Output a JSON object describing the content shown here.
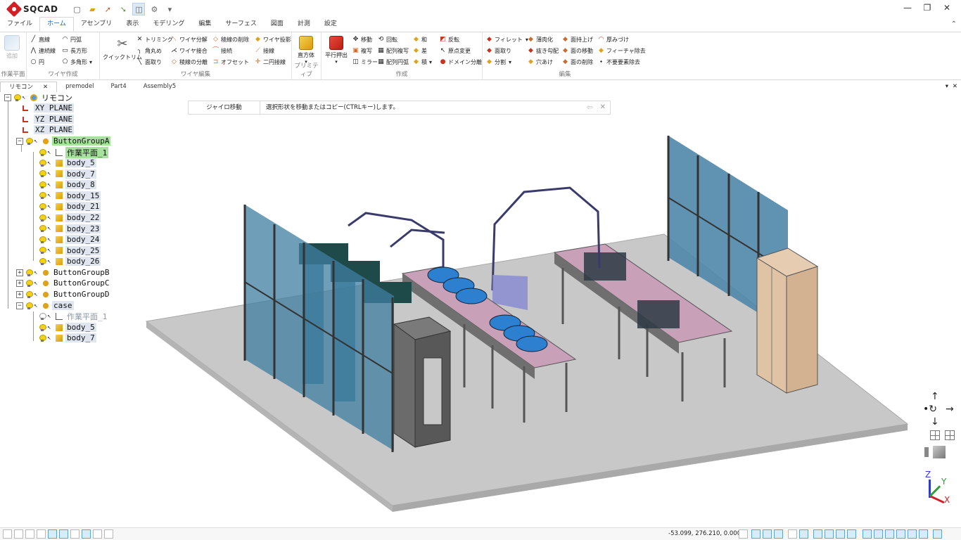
{
  "app": {
    "name": "SQCAD"
  },
  "window": {
    "minimize": "—",
    "restore": "❐",
    "close": "✕"
  },
  "menu": {
    "tabs": [
      "ファイル",
      "ホーム",
      "アセンブリ",
      "表示",
      "モデリング",
      "編集",
      "サーフェス",
      "図面",
      "計測",
      "設定"
    ],
    "active": "ホーム"
  },
  "ribbon": {
    "workplane": {
      "add": "追加",
      "title": "作業平面"
    },
    "wire_create": {
      "line": "直線",
      "arc": "円弧",
      "polyline": "連続線",
      "rect": "長方形",
      "circle": "円",
      "polygon": "多角形",
      "title": "ワイヤ作成"
    },
    "wire_edit": {
      "quicktrim": "クイックトリム",
      "trim": "トリミング",
      "wire_split": "ワイヤ分解",
      "edge_delete": "稜線の削除",
      "wire_project": "ワイヤ投影",
      "round": "角丸め",
      "wire_join": "ワイヤ接合",
      "tangent": "接続",
      "tangent_line": "接線",
      "chamfer": "面取り",
      "edge_split": "稜線の分離",
      "offset": "オフセット",
      "two_circle": "二円接線",
      "title": "ワイヤ編集"
    },
    "primitive": {
      "cube": "直方体",
      "title": "プリミティブ"
    },
    "create": {
      "extrude": "平行押出",
      "move": "移動",
      "rotate": "回転",
      "copy": "複写",
      "array": "配列複写",
      "mirror": "ミラー",
      "array_circle": "配列円弧",
      "union": "和",
      "diff": "差",
      "intersect": "積",
      "flip": "反転",
      "origin": "原点変更",
      "domain": "ドメイン分離",
      "title": "作成"
    },
    "edit": {
      "fillet": "フィレット",
      "chamfer": "面取り",
      "split": "分割",
      "shell": "薄肉化",
      "draft": "抜き勾配",
      "hole": "穴あけ",
      "face_offset": "面持上げ",
      "face_move": "面の移動",
      "face_delete": "面の削除",
      "thicken": "厚みづけ",
      "feature_remove": "フィーチャ除去",
      "cleanup": "不要要素除去",
      "title": "編集"
    }
  },
  "doc_tabs": [
    "リモコン",
    "premodel",
    "Part4",
    "Assembly5"
  ],
  "tree": {
    "root": "リモコン",
    "planes": [
      "XY PLANE",
      "YZ PLANE",
      "XZ PLANE"
    ],
    "groupA": "ButtonGroupA",
    "groupA_plane": "作業平面_1",
    "groupA_bodies": [
      "body_5",
      "body_7",
      "body_8",
      "body_15",
      "body_21",
      "body_22",
      "body_23",
      "body_24",
      "body_25",
      "body_26"
    ],
    "groupB": "ButtonGroupB",
    "groupC": "ButtonGroupC",
    "groupD": "ButtonGroupD",
    "case": "case",
    "case_plane": "作業平面_1",
    "case_bodies": [
      "body_5",
      "body_7"
    ]
  },
  "command": {
    "label": "ジャイロ移動",
    "hint": "選択形状を移動またはコピー(CTRLキー)します。"
  },
  "axes": {
    "x": "X",
    "y": "Y",
    "z": "Z"
  },
  "status": {
    "coords": "-53.099,  276.210,  0.000"
  }
}
